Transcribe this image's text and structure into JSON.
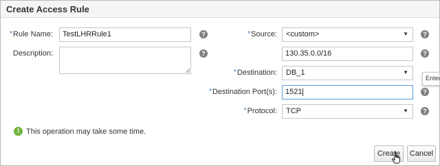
{
  "dialog": {
    "title": "Create Access Rule"
  },
  "form": {
    "rule_name": {
      "label": "Rule Name:",
      "value": "TestLHRRule1"
    },
    "description": {
      "label": "Description:",
      "value": ""
    },
    "source": {
      "label": "Source:",
      "selected": "<custom>",
      "custom_value": "130.35.0.0/16"
    },
    "destination": {
      "label": "Destination:",
      "selected": "DB_1"
    },
    "destination_ports": {
      "label": "Destination Port(s):",
      "value": "1521"
    },
    "protocol": {
      "label": "Protocol:",
      "selected": "TCP"
    },
    "required_mark": "*",
    "help_glyph": "?"
  },
  "tooltip": {
    "text": "Enter"
  },
  "notice": {
    "icon": "exclamation-icon",
    "text": "This operation may take some time."
  },
  "buttons": {
    "create": "Create",
    "cancel": "Cancel"
  },
  "colors": {
    "required": "#2a6fb0",
    "notice_icon": "#6fb33c",
    "help_icon": "#808080"
  }
}
